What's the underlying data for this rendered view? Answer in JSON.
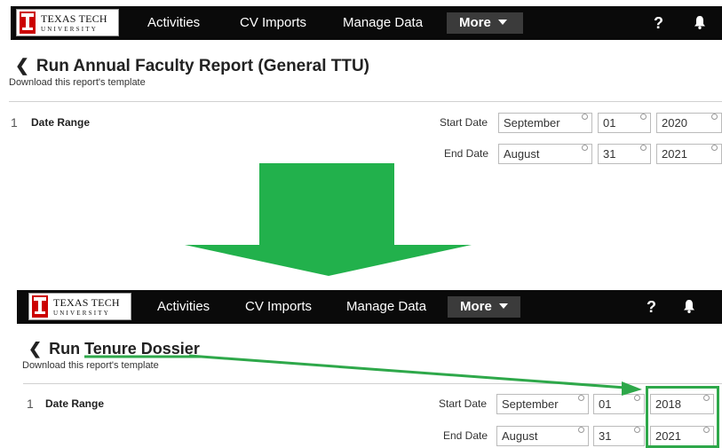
{
  "brand": {
    "name": "TEXAS TECH",
    "sub": "UNIVERSITY"
  },
  "nav": {
    "items": [
      "Activities",
      "CV Imports",
      "Manage Data"
    ],
    "more": "More",
    "help": "?"
  },
  "before": {
    "title_prefix": "Run Annual Faculty Report (General TTU)",
    "subtitle": "Download this report's template",
    "step_number": "1",
    "step_label": "Date Range",
    "start_label": "Start Date",
    "end_label": "End Date",
    "start": {
      "month": "September",
      "day": "01",
      "year": "2020"
    },
    "end": {
      "month": "August",
      "day": "31",
      "year": "2021"
    }
  },
  "after": {
    "title_prefix": "Run",
    "title_highlight": "Tenure Dossier",
    "subtitle": "Download this report's template",
    "step_number": "1",
    "step_label": "Date Range",
    "start_label": "Start Date",
    "end_label": "End Date",
    "start": {
      "month": "September",
      "day": "01",
      "year": "2018"
    },
    "end": {
      "month": "August",
      "day": "31",
      "year": "2021"
    }
  },
  "colors": {
    "navbar": "#0a0a0a",
    "more_bg": "#3b3b3b",
    "annotation_green": "#2ea84a",
    "arrow_green": "#22b14c"
  },
  "icons": {
    "back": "chevron-left-icon",
    "bell": "bell-icon",
    "caret": "caret-down-icon",
    "logo": "double-t-logo-icon"
  }
}
